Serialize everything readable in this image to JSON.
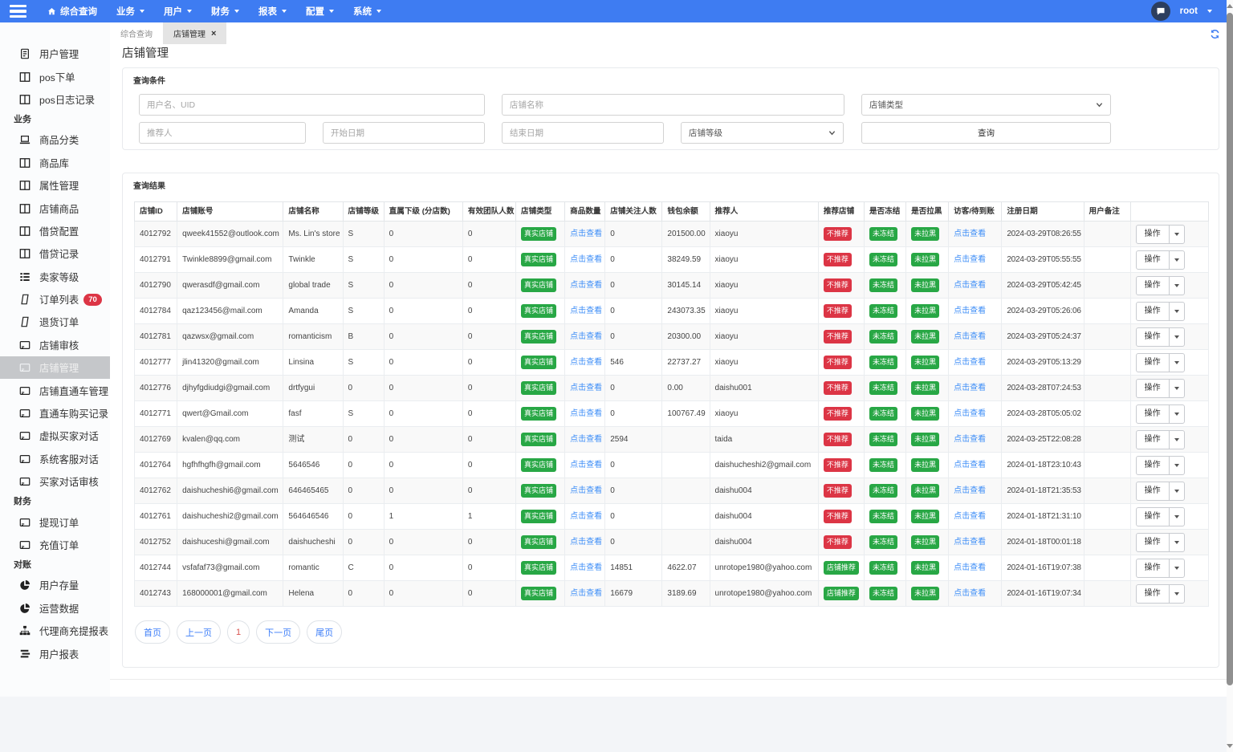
{
  "navbar": {
    "menu": [
      {
        "label": "综合查询",
        "icon": "home",
        "caret": false
      },
      {
        "label": "业务",
        "caret": true
      },
      {
        "label": "用户",
        "caret": true
      },
      {
        "label": "财务",
        "caret": true
      },
      {
        "label": "报表",
        "caret": true
      },
      {
        "label": "配置",
        "caret": true
      },
      {
        "label": "系统",
        "caret": true
      }
    ],
    "user": {
      "name": "root"
    }
  },
  "tabs": [
    {
      "label": "综合查询",
      "active": false
    },
    {
      "label": "店铺管理",
      "active": true,
      "closable": true
    }
  ],
  "page_title": "店铺管理",
  "sidebar": {
    "items": [
      {
        "label": "用户管理",
        "icon": "file"
      },
      {
        "label": "pos下单",
        "icon": "columns"
      },
      {
        "label": "pos日志记录",
        "icon": "columns"
      },
      {
        "section": "业务"
      },
      {
        "label": "商品分类",
        "icon": "laptop"
      },
      {
        "label": "商品库",
        "icon": "columns"
      },
      {
        "label": "属性管理",
        "icon": "columns"
      },
      {
        "label": "店铺商品",
        "icon": "columns"
      },
      {
        "label": "借贷配置",
        "icon": "columns"
      },
      {
        "label": "借贷记录",
        "icon": "columns"
      },
      {
        "label": "卖家等级",
        "icon": "list"
      },
      {
        "label": "订单列表",
        "icon": "note",
        "badge": "70"
      },
      {
        "label": "退货订单",
        "icon": "note"
      },
      {
        "label": "店铺审核",
        "icon": "card"
      },
      {
        "label": "店铺管理",
        "icon": "card",
        "active": true
      },
      {
        "label": "店铺直通车管理",
        "icon": "card"
      },
      {
        "label": "直通车购买记录",
        "icon": "card"
      },
      {
        "label": "虚拟买家对话",
        "icon": "card"
      },
      {
        "label": "系统客服对话",
        "icon": "card"
      },
      {
        "label": "买家对话审核",
        "icon": "card"
      },
      {
        "section": "财务"
      },
      {
        "label": "提现订单",
        "icon": "card"
      },
      {
        "label": "充值订单",
        "icon": "card"
      },
      {
        "section": "对账"
      },
      {
        "label": "用户存量",
        "icon": "pie"
      },
      {
        "label": "运营数据",
        "icon": "pie"
      },
      {
        "label": "代理商充提报表",
        "icon": "sitemap"
      },
      {
        "label": "用户报表",
        "icon": "stream"
      }
    ]
  },
  "query": {
    "title": "查询条件",
    "username_placeholder": "用户名、UID",
    "shop_name_placeholder": "店铺名称",
    "shop_type_placeholder": "店铺类型",
    "referrer_placeholder": "推荐人",
    "start_date_placeholder": "开始日期",
    "end_date_placeholder": "结束日期",
    "shop_level_placeholder": "店铺等级",
    "search_label": "查询"
  },
  "results": {
    "title": "查询结果",
    "headers": [
      "店铺ID",
      "店铺账号",
      "店铺名称",
      "店铺等级",
      "直属下级 (分店数)",
      "有效团队人数",
      "店铺类型",
      "商品数量",
      "店铺关注人数",
      "钱包余额",
      "推荐人",
      "推荐店铺",
      "是否冻结",
      "是否拉黑",
      "访客/待到账",
      "注册日期",
      "用户备注",
      ""
    ],
    "link_label": "点击查看",
    "op_label": "操作",
    "badge_colors": {
      "真实店铺": "#28a745",
      "不推荐": "#dc3545",
      "店铺推荐": "#28a745",
      "未冻结": "#28a745",
      "未拉黑": "#28a745"
    },
    "rows": [
      {
        "id": "4012792",
        "account": "qweek41552@outlook.com",
        "name": "Ms. Lin's store",
        "level": "S",
        "directSub": "0",
        "team": "0",
        "type": "真实店铺",
        "followers": "0",
        "wallet": "201500.00",
        "referrer": "xiaoyu",
        "recommend": "不推荐",
        "frozen": "未冻结",
        "blacklist": "未拉黑",
        "date": "2024-03-29T08:26:55",
        "note": ""
      },
      {
        "id": "4012791",
        "account": "Twinkle8899@gmail.com",
        "name": "Twinkle",
        "level": "S",
        "directSub": "0",
        "team": "0",
        "type": "真实店铺",
        "followers": "0",
        "wallet": "38249.59",
        "referrer": "xiaoyu",
        "recommend": "不推荐",
        "frozen": "未冻结",
        "blacklist": "未拉黑",
        "date": "2024-03-29T05:55:55",
        "note": ""
      },
      {
        "id": "4012790",
        "account": "qwerasdf@gmail.com",
        "name": "global trade",
        "level": "S",
        "directSub": "0",
        "team": "0",
        "type": "真实店铺",
        "followers": "0",
        "wallet": "30145.14",
        "referrer": "xiaoyu",
        "recommend": "不推荐",
        "frozen": "未冻结",
        "blacklist": "未拉黑",
        "date": "2024-03-29T05:42:45",
        "note": ""
      },
      {
        "id": "4012784",
        "account": "qaz123456@mail.com",
        "name": "Amanda",
        "level": "S",
        "directSub": "0",
        "team": "0",
        "type": "真实店铺",
        "followers": "0",
        "wallet": "243073.35",
        "referrer": "xiaoyu",
        "recommend": "不推荐",
        "frozen": "未冻结",
        "blacklist": "未拉黑",
        "date": "2024-03-29T05:26:06",
        "note": ""
      },
      {
        "id": "4012781",
        "account": "qazwsx@gmail.com",
        "name": "romanticism",
        "level": "B",
        "directSub": "0",
        "team": "0",
        "type": "真实店铺",
        "followers": "0",
        "wallet": "20300.00",
        "referrer": "xiaoyu",
        "recommend": "不推荐",
        "frozen": "未冻结",
        "blacklist": "未拉黑",
        "date": "2024-03-29T05:24:37",
        "note": ""
      },
      {
        "id": "4012777",
        "account": "jlin41320@gmail.com",
        "name": "Linsina",
        "level": "S",
        "directSub": "0",
        "team": "0",
        "type": "真实店铺",
        "followers": "546",
        "wallet": "22737.27",
        "referrer": "xiaoyu",
        "recommend": "不推荐",
        "frozen": "未冻结",
        "blacklist": "未拉黑",
        "date": "2024-03-29T05:13:29",
        "note": ""
      },
      {
        "id": "4012776",
        "account": "djhyfgdiudgi@gmail.com",
        "name": "drtfygui",
        "level": "0",
        "directSub": "0",
        "team": "0",
        "type": "真实店铺",
        "followers": "0",
        "wallet": "0.00",
        "referrer": "daishu001",
        "recommend": "不推荐",
        "frozen": "未冻结",
        "blacklist": "未拉黑",
        "date": "2024-03-28T07:24:53",
        "note": ""
      },
      {
        "id": "4012771",
        "account": "qwert@Gmail.com",
        "name": "fasf",
        "level": "S",
        "directSub": "0",
        "team": "0",
        "type": "真实店铺",
        "followers": "0",
        "wallet": "100767.49",
        "referrer": "xiaoyu",
        "recommend": "不推荐",
        "frozen": "未冻结",
        "blacklist": "未拉黑",
        "date": "2024-03-28T05:05:02",
        "note": ""
      },
      {
        "id": "4012769",
        "account": "kvalen@qq.com",
        "name": "测试",
        "level": "0",
        "directSub": "0",
        "team": "0",
        "type": "真实店铺",
        "followers": "2594",
        "wallet": "",
        "referrer": "taida",
        "recommend": "不推荐",
        "frozen": "未冻结",
        "blacklist": "未拉黑",
        "date": "2024-03-25T22:08:28",
        "note": ""
      },
      {
        "id": "4012764",
        "account": "hgfhfhgfh@gmail.com",
        "name": "5646546",
        "level": "0",
        "directSub": "0",
        "team": "0",
        "type": "真实店铺",
        "followers": "0",
        "wallet": "",
        "referrer": "daishucheshi2@gmail.com",
        "recommend": "不推荐",
        "frozen": "未冻结",
        "blacklist": "未拉黑",
        "date": "2024-01-18T23:10:43",
        "note": ""
      },
      {
        "id": "4012762",
        "account": "daishucheshi6@gmail.com",
        "name": "646465465",
        "level": "0",
        "directSub": "0",
        "team": "0",
        "type": "真实店铺",
        "followers": "0",
        "wallet": "",
        "referrer": "daishu004",
        "recommend": "不推荐",
        "frozen": "未冻结",
        "blacklist": "未拉黑",
        "date": "2024-01-18T21:35:53",
        "note": ""
      },
      {
        "id": "4012761",
        "account": "daishucheshi2@gmail.com",
        "name": "564646546",
        "level": "0",
        "directSub": "1",
        "team": "1",
        "type": "真实店铺",
        "followers": "0",
        "wallet": "",
        "referrer": "daishu004",
        "recommend": "不推荐",
        "frozen": "未冻结",
        "blacklist": "未拉黑",
        "date": "2024-01-18T21:31:10",
        "note": ""
      },
      {
        "id": "4012752",
        "account": "daishuceshi@gmail.com",
        "name": "daishucheshi",
        "level": "0",
        "directSub": "0",
        "team": "0",
        "type": "真实店铺",
        "followers": "0",
        "wallet": "",
        "referrer": "daishu004",
        "recommend": "不推荐",
        "frozen": "未冻结",
        "blacklist": "未拉黑",
        "date": "2024-01-18T00:01:18",
        "note": ""
      },
      {
        "id": "4012744",
        "account": "vsfafaf73@gmail.com",
        "name": "romantic",
        "level": "C",
        "directSub": "0",
        "team": "0",
        "type": "真实店铺",
        "followers": "14851",
        "wallet": "4622.07",
        "referrer": "unrotope1980@yahoo.com",
        "recommend": "店铺推荐",
        "frozen": "未冻结",
        "blacklist": "未拉黑",
        "date": "2024-01-16T19:07:38",
        "note": ""
      },
      {
        "id": "4012743",
        "account": "168000001@gmail.com",
        "name": "Helena",
        "level": "0",
        "directSub": "0",
        "team": "0",
        "type": "真实店铺",
        "followers": "16679",
        "wallet": "3189.69",
        "referrer": "unrotope1980@yahoo.com",
        "recommend": "店铺推荐",
        "frozen": "未冻结",
        "blacklist": "未拉黑",
        "date": "2024-01-16T19:07:34",
        "note": ""
      }
    ],
    "pagination": [
      {
        "label": "首页"
      },
      {
        "label": "上一页"
      },
      {
        "label": "1",
        "current": true
      },
      {
        "label": "下一页"
      },
      {
        "label": "尾页"
      }
    ]
  }
}
